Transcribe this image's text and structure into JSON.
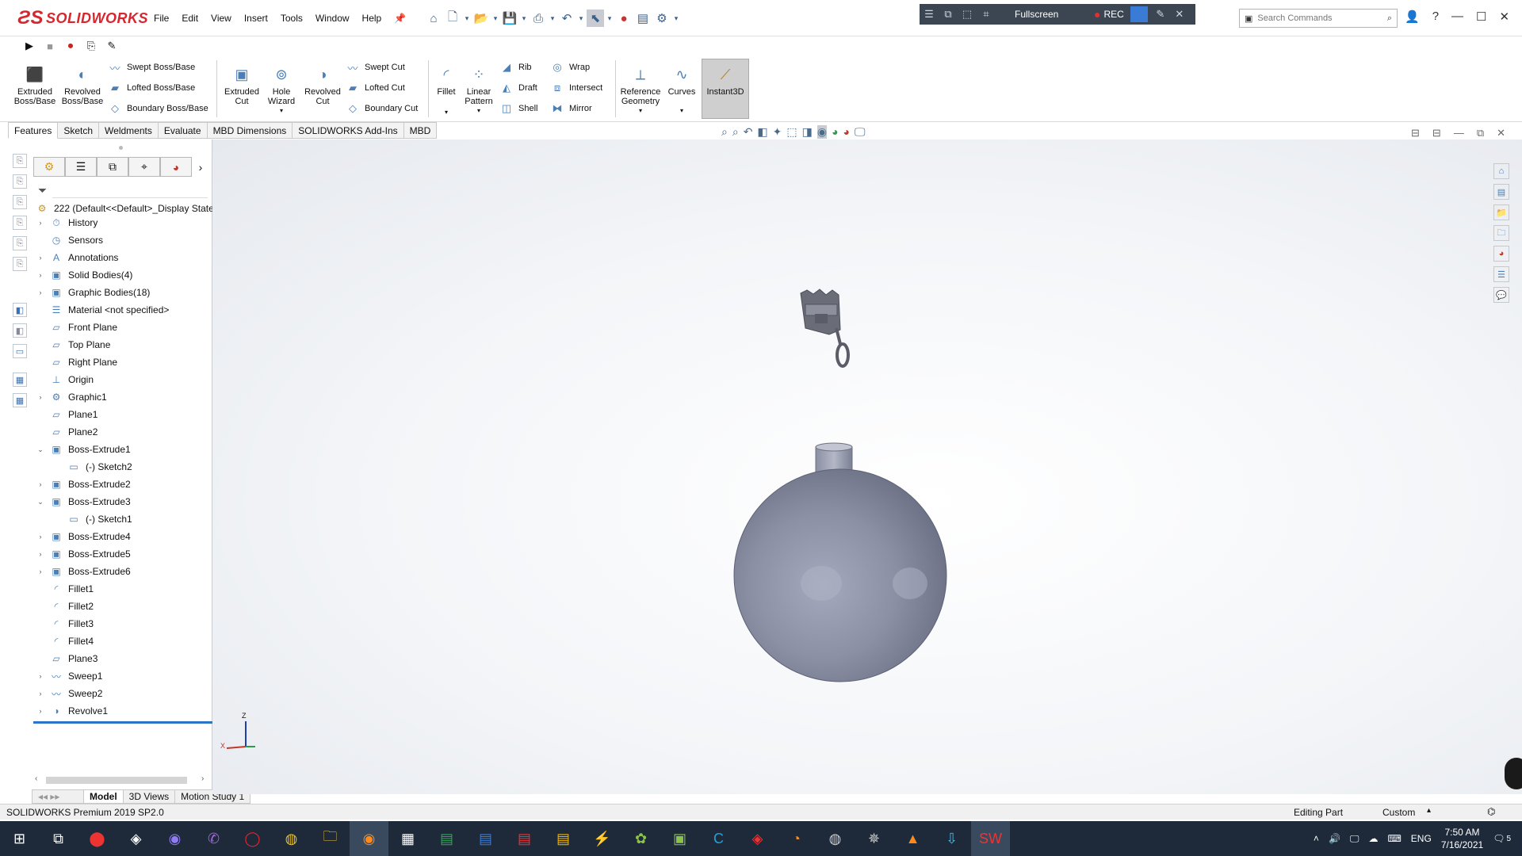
{
  "app": {
    "brand": "SOLIDWORKS"
  },
  "menu": [
    "File",
    "Edit",
    "View",
    "Insert",
    "Tools",
    "Window",
    "Help"
  ],
  "recorder": {
    "fullscreen_label": "Fullscreen",
    "rec_label": "REC"
  },
  "search": {
    "placeholder": "Search Commands"
  },
  "ribbon": {
    "extruded_boss": "Extruded Boss/Base",
    "revolved_boss": "Revolved Boss/Base",
    "swept_boss": "Swept Boss/Base",
    "lofted_boss": "Lofted Boss/Base",
    "boundary_boss": "Boundary Boss/Base",
    "extruded_cut": "Extruded Cut",
    "hole_wizard": "Hole Wizard",
    "revolved_cut": "Revolved Cut",
    "swept_cut": "Swept Cut",
    "lofted_cut": "Lofted Cut",
    "boundary_cut": "Boundary Cut",
    "fillet": "Fillet",
    "linear_pattern": "Linear Pattern",
    "rib": "Rib",
    "draft": "Draft",
    "shell": "Shell",
    "wrap": "Wrap",
    "intersect": "Intersect",
    "mirror": "Mirror",
    "reference_geometry": "Reference Geometry",
    "curves": "Curves",
    "instant3d": "Instant3D"
  },
  "tabs": [
    "Features",
    "Sketch",
    "Weldments",
    "Evaluate",
    "MBD Dimensions",
    "SOLIDWORKS Add-Ins",
    "MBD"
  ],
  "tree": {
    "root": "222  (Default<<Default>_Display State",
    "items": [
      {
        "label": "History",
        "expand": "›"
      },
      {
        "label": "Sensors",
        "expand": ""
      },
      {
        "label": "Annotations",
        "expand": "›"
      },
      {
        "label": "Solid Bodies(4)",
        "expand": "›"
      },
      {
        "label": "Graphic Bodies(18)",
        "expand": "›"
      },
      {
        "label": "Material <not specified>",
        "expand": ""
      },
      {
        "label": "Front Plane",
        "expand": ""
      },
      {
        "label": "Top Plane",
        "expand": ""
      },
      {
        "label": "Right Plane",
        "expand": ""
      },
      {
        "label": "Origin",
        "expand": ""
      },
      {
        "label": "Graphic1",
        "expand": "›"
      },
      {
        "label": "Plane1",
        "expand": ""
      },
      {
        "label": "Plane2",
        "expand": ""
      },
      {
        "label": "Boss-Extrude1",
        "expand": "⌄"
      },
      {
        "label": "(-) Sketch2",
        "expand": ""
      },
      {
        "label": "Boss-Extrude2",
        "expand": "›"
      },
      {
        "label": "Boss-Extrude3",
        "expand": "⌄"
      },
      {
        "label": "(-) Sketch1",
        "expand": ""
      },
      {
        "label": "Boss-Extrude4",
        "expand": "›"
      },
      {
        "label": "Boss-Extrude5",
        "expand": "›"
      },
      {
        "label": "Boss-Extrude6",
        "expand": "›"
      },
      {
        "label": "Fillet1",
        "expand": ""
      },
      {
        "label": "Fillet2",
        "expand": ""
      },
      {
        "label": "Fillet3",
        "expand": ""
      },
      {
        "label": "Fillet4",
        "expand": ""
      },
      {
        "label": "Plane3",
        "expand": ""
      },
      {
        "label": "Sweep1",
        "expand": "›"
      },
      {
        "label": "Sweep2",
        "expand": "›"
      },
      {
        "label": "Revolve1",
        "expand": "›"
      }
    ]
  },
  "bottom_tabs": [
    "Model",
    "3D Views",
    "Motion Study 1"
  ],
  "triad": {
    "z": "Z",
    "x": "X"
  },
  "status": {
    "version": "SOLIDWORKS Premium 2019 SP2.0",
    "mode": "Editing Part",
    "units": "Custom"
  },
  "clock": {
    "time": "7:50 AM",
    "date": "7/16/2021",
    "lang": "ENG",
    "notif": "5"
  }
}
